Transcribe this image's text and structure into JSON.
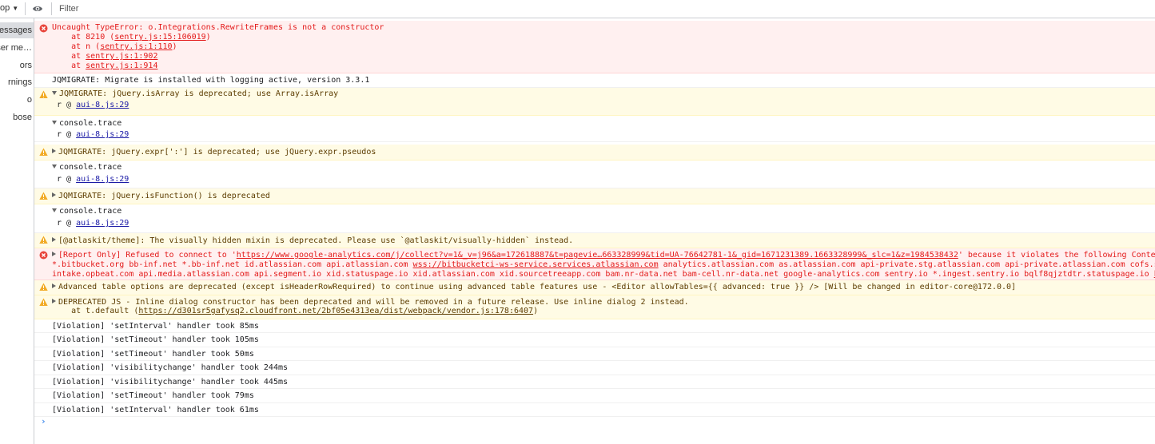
{
  "toolbar": {
    "context_label": "op",
    "filter_placeholder": "Filter"
  },
  "sidebar": {
    "items": [
      "essages",
      "ser me…",
      "ors",
      "rnings",
      "o",
      "bose"
    ]
  },
  "error1": {
    "title": "Uncaught TypeError: o.Integrations.RewriteFrames is not a constructor",
    "stack": [
      {
        "prefix": "    at 8210 (",
        "link": "sentry.js:15:106019",
        "suffix": ")"
      },
      {
        "prefix": "    at n (",
        "link": "sentry.js:1:110",
        "suffix": ")"
      },
      {
        "prefix": "    at ",
        "link": "sentry.js:1:902",
        "suffix": ""
      },
      {
        "prefix": "    at ",
        "link": "sentry.js:1:914",
        "suffix": ""
      }
    ]
  },
  "log1": "JQMIGRATE: Migrate is installed with logging active, version 3.3.1",
  "warn1": {
    "text": "JQMIGRATE: jQuery.isArray is deprecated; use Array.isArray",
    "src_prefix": "r @ ",
    "src": "aui-8.js:29"
  },
  "trace1": {
    "text": "console.trace",
    "src_prefix": "r @ ",
    "src": "aui-8.js:29"
  },
  "warn2": {
    "text": "JQMIGRATE: jQuery.expr[':'] is deprecated; use jQuery.expr.pseudos"
  },
  "trace2": {
    "text": "console.trace",
    "src_prefix": "r @ ",
    "src": "aui-8.js:29"
  },
  "warn3": {
    "text": "JQMIGRATE: jQuery.isFunction() is deprecated"
  },
  "trace3": {
    "text": "console.trace",
    "src_prefix": "r @ ",
    "src": "aui-8.js:29"
  },
  "warn4": {
    "text": "[@atlaskit/theme]: The visually hidden mixin is deprecated. Please use `@atlaskit/visually-hidden` instead."
  },
  "error2": {
    "line1_prefix": "[Report Only] Refused to connect to '",
    "line1_link": "https://www.google-analytics.com/j/collect?v=1&_v=j96&a=172618887&t=pagevie…663328999&tid=UA-76642781-1&_gid=1671231389.1663328999&_slc=1&z=1984538432",
    "line1_suffix": "' because it violates the following Content",
    "line2_a": "*.bitbucket.org bb-inf.net *.bb-inf.net id.atlassian.com api.atlassian.com ",
    "line2_link": "wss://bitbucketci-ws-service.services.atlassian.com",
    "line2_b": " analytics.atlassian.com as.atlassian.com api-private.stg.atlassian.com api-private.atlassian.com cofs.sta",
    "line3_a": "intake.opbeat.com api.media.atlassian.com api.segment.io xid.statuspage.io xid.atlassian.com xid.sourcetreeapp.com bam.nr-data.net bam-cell.nr-data.net google-analytics.com sentry.io *.ingest.sentry.io bqlf8qjztdtr.statuspage.io ",
    "line3_link": "htt"
  },
  "warn5": {
    "text": "Advanced table options are deprecated (except isHeaderRowRequired) to continue using advanced table features use - <Editor allowTables={{ advanced: true }} /> [Will be changed in editor-core@172.0.0]"
  },
  "warn6": {
    "text": "DEPRECATED JS - Inline dialog constructor has been deprecated and will be removed in a future release. Use inline dialog 2 instead.",
    "line2_prefix": "    at t.default (",
    "line2_link": "https://d301sr5gafysq2.cloudfront.net/2bf05e4313ea/dist/webpack/vendor.js:178:6407",
    "line2_suffix": ")"
  },
  "violations": [
    "[Violation] 'setInterval' handler took 85ms",
    "[Violation] 'setTimeout' handler took 105ms",
    "[Violation] 'setTimeout' handler took 50ms",
    "[Violation] 'visibilitychange' handler took 244ms",
    "[Violation] 'visibilitychange' handler took 445ms",
    "[Violation] 'setTimeout' handler took 79ms",
    "[Violation] 'setInterval' handler took 61ms"
  ],
  "prompt_symbol": "›"
}
